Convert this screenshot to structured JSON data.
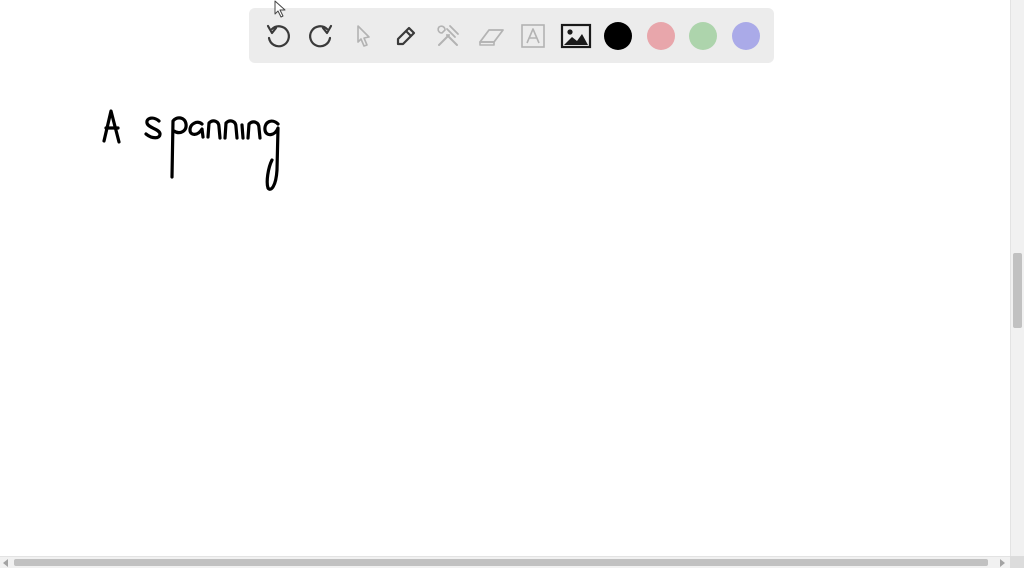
{
  "canvas": {
    "handwritten_text": "A spanning"
  },
  "toolbar": {
    "tools": [
      {
        "name": "undo-icon",
        "state": "enabled"
      },
      {
        "name": "redo-icon",
        "state": "enabled"
      },
      {
        "name": "select-pointer-icon",
        "state": "disabled"
      },
      {
        "name": "pen-icon",
        "state": "enabled"
      },
      {
        "name": "tools-icon",
        "state": "disabled"
      },
      {
        "name": "eraser-icon",
        "state": "disabled"
      },
      {
        "name": "text-box-icon",
        "state": "disabled"
      },
      {
        "name": "image-icon",
        "state": "enabled"
      }
    ],
    "colors": [
      {
        "name": "black",
        "hex": "#000000",
        "selected": true
      },
      {
        "name": "pink",
        "hex": "#e8a6ab",
        "selected": false
      },
      {
        "name": "green",
        "hex": "#add4ac",
        "selected": false
      },
      {
        "name": "purple",
        "hex": "#aaaae8",
        "selected": false
      }
    ]
  }
}
